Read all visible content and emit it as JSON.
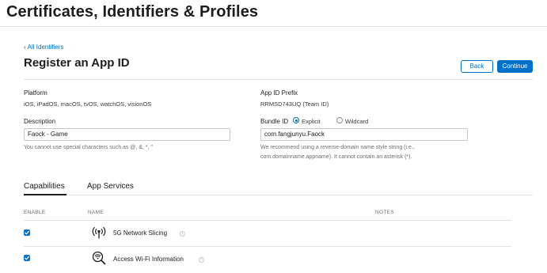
{
  "header": {
    "title": "Certificates, Identifiers & Profiles"
  },
  "nav": {
    "back_link_chevron": "‹",
    "back_link_label": "All Identifiers"
  },
  "form": {
    "title": "Register an App ID",
    "back_button": "Back",
    "continue_button": "Continue",
    "platform_label": "Platform",
    "platform_value": "iOS, iPadOS, macOS, tvOS, watchOS, visionOS",
    "prefix_label": "App ID Prefix",
    "prefix_value": "RRMSD743UQ (Team ID)",
    "description_label": "Description",
    "description_value": "Faock - Game",
    "description_hint": "You cannot use special characters such as @, &, *, \"",
    "bundle_label": "Bundle ID",
    "bundle_explicit_label": "Explicit",
    "bundle_wildcard_label": "Wildcard",
    "bundle_selected": "Explicit",
    "bundle_value": "com.fangjunyu.Faock",
    "bundle_hint_line1": "We recommend using a reverse-domain name style string (i.e.,",
    "bundle_hint_line2": "com.domainname.appname). It cannot contain an asterisk (*)."
  },
  "tabs": [
    {
      "label": "Capabilities",
      "active": true
    },
    {
      "label": "App Services",
      "active": false
    }
  ],
  "table": {
    "headers": {
      "enable": "ENABLE",
      "name": "NAME",
      "notes": "NOTES"
    },
    "rows": [
      {
        "name": "5G Network Slicing",
        "enabled": true,
        "icon": "antenna-icon"
      },
      {
        "name": "Access Wi-Fi Information",
        "enabled": true,
        "icon": "wifi-search-icon"
      }
    ]
  },
  "colors": {
    "accent": "#0070c9",
    "text": "#1d1d1f",
    "muted": "#6e6e73"
  }
}
